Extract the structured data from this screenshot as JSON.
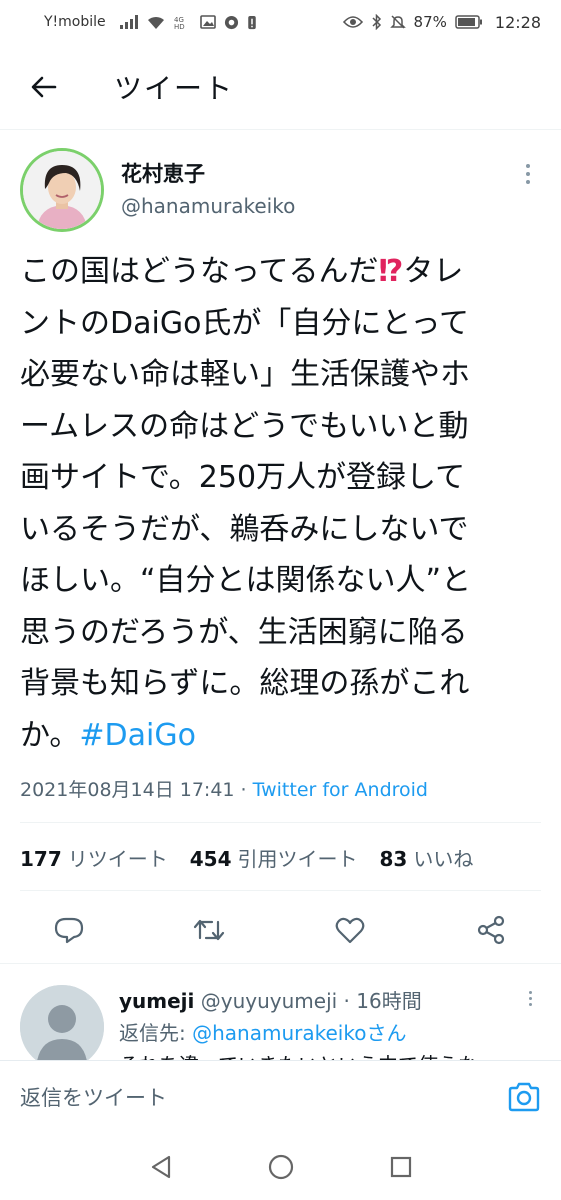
{
  "status_bar": {
    "carrier": "Y!mobile",
    "battery": "87%",
    "time": "12:28",
    "icons": [
      "signal-icon",
      "wifi-icon",
      "data-icon",
      "image-icon",
      "chrome-icon",
      "alert-icon",
      "eye-icon",
      "bluetooth-icon",
      "mute-icon",
      "battery-icon"
    ]
  },
  "header": {
    "title": "ツイート",
    "back_icon": "back-arrow-icon"
  },
  "tweet": {
    "author_name": "花村恵子",
    "author_handle": "@hanamurakeiko",
    "lines": [
      "この国はどうなってるんだ",
      "ントのDaiGo氏が「自分にとって",
      "必要ない命は軽い」生活保護やホ",
      "ームレスの命はどうでもいいと動",
      "画サイトで。250万人が登録して",
      "いるそうだが、鵜呑みにしないで",
      "ほしい。“自分とは関係ない人”と",
      "思うのだろうが、生活困窮に陥る",
      "背景も知らずに。総理の孫がこれ",
      "か。"
    ],
    "line1_emoji": "⁉",
    "line1_tail": "タレ",
    "hashtag": "#DaiGo",
    "timestamp": "2021年08月14日 17:41",
    "separator": " · ",
    "source": "Twitter for Android"
  },
  "stats": {
    "retweets_count": "177",
    "retweets_label": "リツイート",
    "quotes_count": "454",
    "quotes_label": "引用ツイート",
    "likes_count": "83",
    "likes_label": "いいね"
  },
  "actions": [
    "reply-icon",
    "retweet-icon",
    "like-icon",
    "share-icon"
  ],
  "reply": {
    "name": "yumeji",
    "handle": "@yuyuyumeji",
    "separator": " · ",
    "time": "16時間",
    "reply_to_label": "返信先: ",
    "reply_to_mention": "@hanamurakeikoさん",
    "peek_text": "それを違っていきたいという中で使うな"
  },
  "compose": {
    "placeholder": "返信をツイート"
  },
  "colors": {
    "accent": "#1d9bf0",
    "avatar_ring": "#7bd06b",
    "text_primary": "#0f1419",
    "text_secondary": "#536471"
  }
}
